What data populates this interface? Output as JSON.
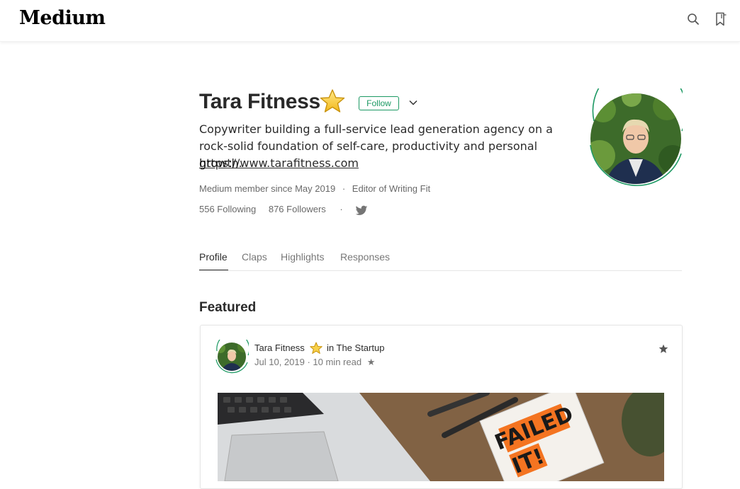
{
  "header": {
    "logo": "Medium",
    "icons": [
      "search-icon",
      "bookmark-icon"
    ]
  },
  "profile": {
    "name": "Tara Fitness",
    "badge_icon": "star-icon",
    "follow_label": "Follow",
    "bio": "Copywriter building a full-service lead generation agency on a rock-solid foundation of self-care, productivity and personal growth.",
    "website": "https://www.tarafitness.com",
    "member_since": "Medium member since May 2019",
    "meta_separator": "·",
    "editor_of": "Editor of Writing Fit",
    "following": "556 Following",
    "followers": "876 Followers",
    "counts_separator": "·",
    "social_icon": "twitter-icon"
  },
  "tabs": [
    {
      "label": "Profile",
      "active": true
    },
    {
      "label": "Claps",
      "active": false
    },
    {
      "label": "Highlights",
      "active": false
    },
    {
      "label": "Responses",
      "active": false
    }
  ],
  "featured": {
    "heading": "Featured",
    "post": {
      "author": "Tara Fitness",
      "in_label": "in",
      "publication": "The Startup",
      "date": "Jul 10, 2019",
      "read_time": "· 10 min read",
      "member_star": "★",
      "image_text": "FAILED IT!"
    }
  },
  "colors": {
    "accent_green": "#1c9963",
    "text": "#292929",
    "muted": "#757575"
  }
}
